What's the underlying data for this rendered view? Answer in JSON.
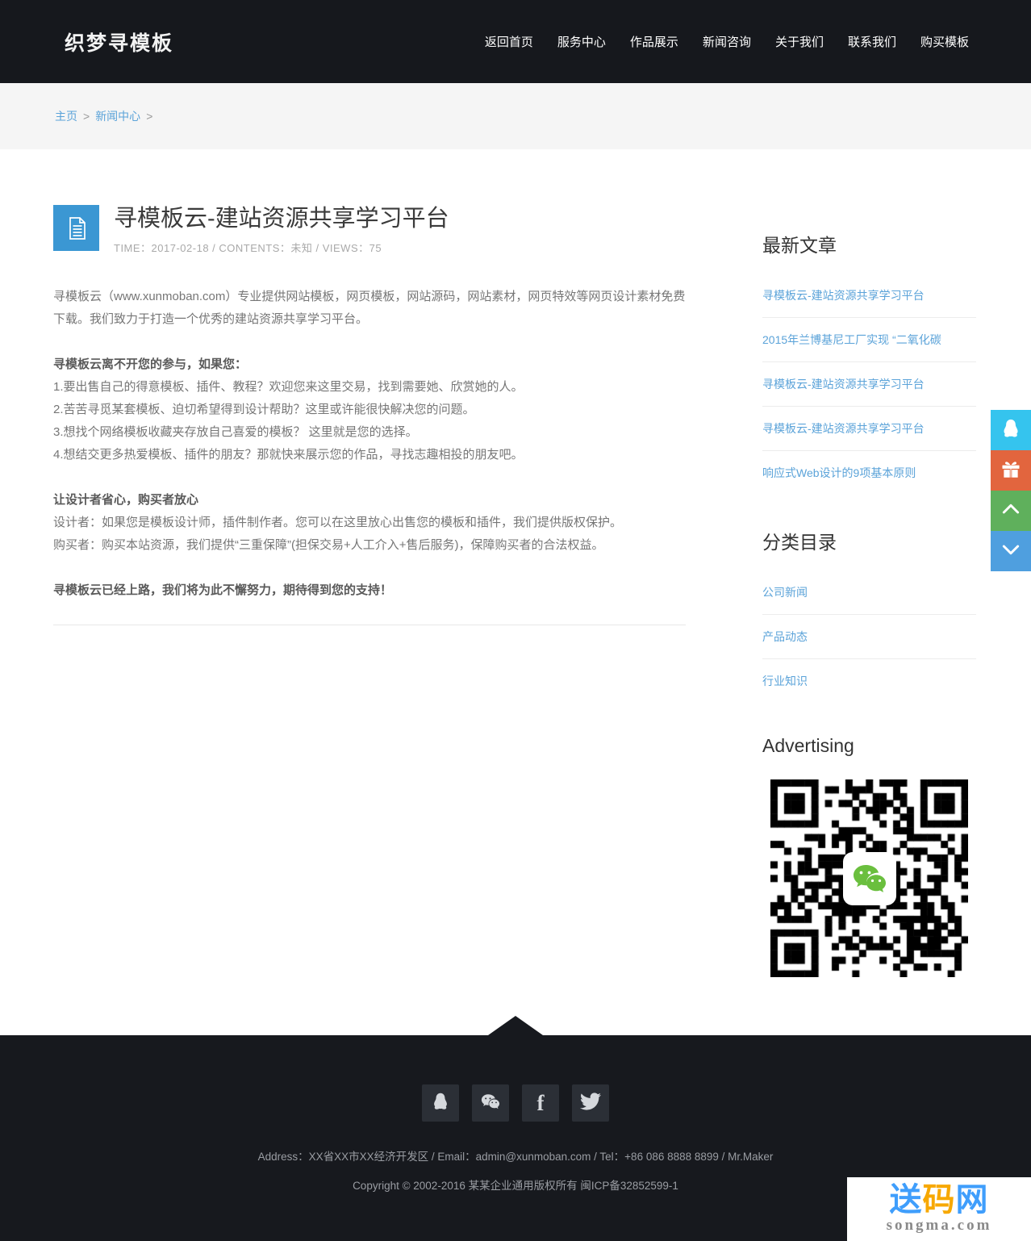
{
  "colors": {
    "header_bg": "#16181d",
    "breadcrumb_bg": "#f5f5f5",
    "link_blue": "#5ba3d9",
    "accent_blue": "#3b97d3",
    "qq_btn": "#35c4ee",
    "gift_btn": "#e2653e",
    "up_btn": "#5fb05c",
    "down_btn": "#4f9fdf",
    "footer_bg": "#17191e",
    "footer_icon_bg": "#2b2f36",
    "wechat_green": "#6abf3e",
    "watermark_blue": "#3f9efc",
    "watermark_orange": "#f7a800"
  },
  "header": {
    "logo": "织梦寻模板",
    "nav": [
      "返回首页",
      "服务中心",
      "作品展示",
      "新闻咨询",
      "关于我们",
      "联系我们",
      "购买模板"
    ]
  },
  "breadcrumb": {
    "home": "主页",
    "section": "新闻中心",
    "separator": ">"
  },
  "article": {
    "title": "寻模板云-建站资源共享学习平台",
    "meta": "TIME：2017-02-18 / CONTENTS：未知 / VIEWS：75",
    "paragraphs": [
      "寻模板云（www.xunmoban.com）专业提供网站模板，网页模板，网站源码，网站素材，网页特效等网页设计素材免费下载。我们致力于打造一个优秀的建站资源共享学习平台。",
      "寻模板云离不开您的参与，如果您：",
      "1.要出售自己的得意模板、插件、教程？欢迎您来这里交易，找到需要她、欣赏她的人。",
      "2.苦苦寻觅某套模板、迫切希望得到设计帮助？这里或许能很快解决您的问题。",
      "3.想找个网络模板收藏夹存放自己喜爱的模板？ 这里就是您的选择。",
      "4.想结交更多热爱模板、插件的朋友？那就快来展示您的作品，寻找志趣相投的朋友吧。",
      "让设计者省心，购买者放心",
      "设计者：如果您是模板设计师，插件制作者。您可以在这里放心出售您的模板和插件，我们提供版权保护。",
      "购买者：购买本站资源，我们提供“三重保障”(担保交易+人工介入+售后服务)，保障购买者的合法权益。",
      "寻模板云已经上路，我们将为此不懈努力，期待得到您的支持！"
    ]
  },
  "sidebar": {
    "latest_title": "最新文章",
    "latest": [
      "寻模板云-建站资源共享学习平台",
      "2015年兰博基尼工厂实现 “二氧化碳",
      "寻模板云-建站资源共享学习平台",
      "寻模板云-建站资源共享学习平台",
      "响应式Web设计的9项基本原则"
    ],
    "category_title": "分类目录",
    "categories": [
      "公司新闻",
      "产品动态",
      "行业知识"
    ],
    "ad_title": "Advertising"
  },
  "footer": {
    "address": "Address：XX省XX市XX经济开发区 / Email：admin@xunmoban.com / Tel：+86 086 8888 8899 / Mr.Maker",
    "copyright": "Copyright © 2002-2016 某某企业通用版权所有  闽ICP备32852599-1"
  },
  "watermark": {
    "cn_1": "送",
    "cn_2": "码",
    "cn_3": "网",
    "en": "songma.com"
  }
}
